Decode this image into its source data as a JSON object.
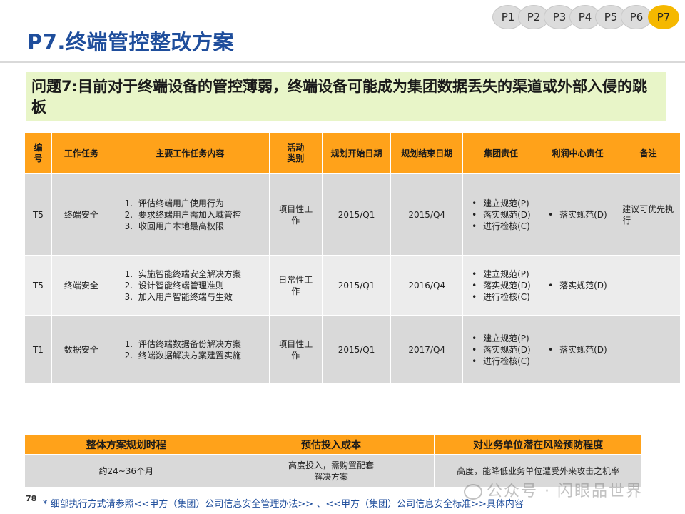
{
  "tabs": [
    "P1",
    "P2",
    "P3",
    "P4",
    "P5",
    "P6",
    "P7"
  ],
  "active_tab": "P7",
  "title": "P7.终端管控整改方案",
  "problem": "问题7:目前对于终端设备的管控薄弱，终端设备可能成为集团数据丢失的渠道或外部入侵的跳板",
  "table": {
    "headers": [
      "编号",
      "工作任务",
      "主要工作任务内容",
      "活动类别",
      "规划开始日期",
      "规划结束日期",
      "集团责任",
      "利润中心责任",
      "备注"
    ],
    "rows": [
      {
        "id": "T5",
        "task": "终端安全",
        "items": [
          "评估终端用户使用行为",
          "要求终端用户需加入域管控",
          "收回用户本地最高权限"
        ],
        "category": "项目性工作",
        "start": "2015/Q1",
        "end": "2015/Q4",
        "group": [
          "建立规范(P)",
          "落实规范(D)",
          "进行检核(C)"
        ],
        "profit": [
          "落实规范(D)"
        ],
        "note": "建议可优先执行"
      },
      {
        "id": "T5",
        "task": "终端安全",
        "items": [
          "实施智能终端安全解决方案",
          "设计智能终端管理准则",
          "加入用户智能终端与生效"
        ],
        "category": "日常性工作",
        "start": "2015/Q1",
        "end": "2016/Q4",
        "group": [
          "建立规范(P)",
          "落实规范(D)",
          "进行检核(C)"
        ],
        "profit": [
          "落实规范(D)"
        ],
        "note": ""
      },
      {
        "id": "T1",
        "task": "数据安全",
        "items": [
          "评估终端数据备份解决方案",
          "终端数据解决方案建置实施"
        ],
        "category": "项目性工作",
        "start": "2015/Q1",
        "end": "2017/Q4",
        "group": [
          "建立规范(P)",
          "落实规范(D)",
          "进行检核(C)"
        ],
        "profit": [
          "落实规范(D)"
        ],
        "note": ""
      }
    ]
  },
  "summary": {
    "headers": [
      "整体方案规划时程",
      "预估投入成本",
      "对业务单位潜在风险预防程度"
    ],
    "values": [
      "约24~36个月",
      "高度投入，需购置配套解决方案",
      "高度，能降低业务单位遭受外来攻击之机率"
    ]
  },
  "page_number": "78",
  "footnote": "* 细部执行方式请参照<<甲方（集团）公司信息安全管理办法>> 、<<甲方（集团）公司信息安全标准>>具体内容",
  "watermark": "公众号 · 闪眼品世界",
  "colors": {
    "title": "#1f4e9c",
    "header": "#ffa21a",
    "active_tab": "#f5b800",
    "problem_bg": "#e8f5c8"
  }
}
